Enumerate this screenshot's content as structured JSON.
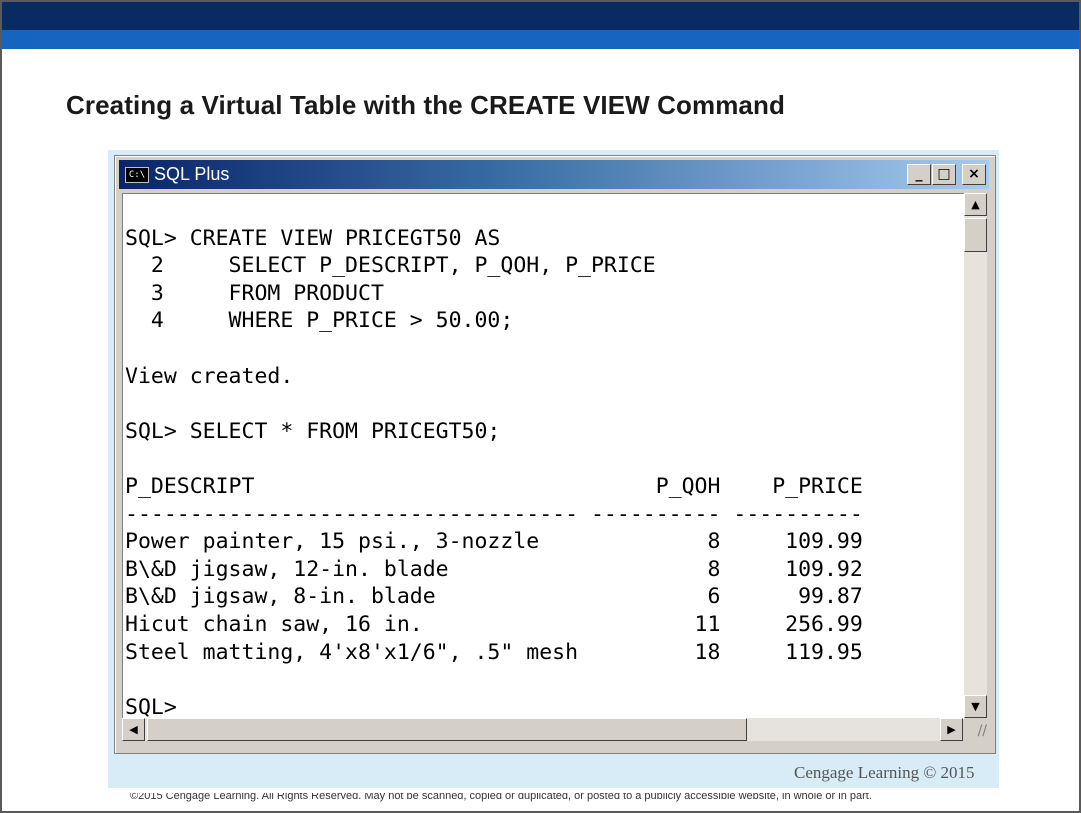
{
  "slide": {
    "title": "Creating a Virtual Table with the CREATE VIEW Command",
    "credit": "Cengage Learning © 2015",
    "copyright": "©2015 Cengage Learning. All Rights Reserved. May not be scanned, copied or duplicated, or posted to a publicly accessible website, in whole or in part.",
    "band_dark_color": "#0a2a63",
    "band_light_color": "#1565c0"
  },
  "window": {
    "title": "SQL Plus",
    "icon_text": "C:\\",
    "buttons": {
      "minimize": "_",
      "maximize": "□",
      "close": "×"
    }
  },
  "console": {
    "lines": [
      "",
      "SQL> CREATE VIEW PRICEGT50 AS",
      "  2     SELECT P_DESCRIPT, P_QOH, P_PRICE",
      "  3     FROM PRODUCT",
      "  4     WHERE P_PRICE > 50.00;",
      "",
      "View created.",
      "",
      "SQL> SELECT * FROM PRICEGT50;",
      "",
      "P_DESCRIPT                               P_QOH    P_PRICE",
      "----------------------------------- ---------- ----------",
      "Power painter, 15 psi., 3-nozzle             8     109.99",
      "B\\&D jigsaw, 12-in. blade                    8     109.92",
      "B\\&D jigsaw, 8-in. blade                     6      99.87",
      "Hicut chain saw, 16 in.                     11     256.99",
      "Steel matting, 4'x8'x1/6\", .5\" mesh         18     119.95",
      "",
      "SQL>"
    ]
  },
  "scrollbar": {
    "up": "▲",
    "down": "▼",
    "left": "◀",
    "right": "▶",
    "grip": "//"
  }
}
